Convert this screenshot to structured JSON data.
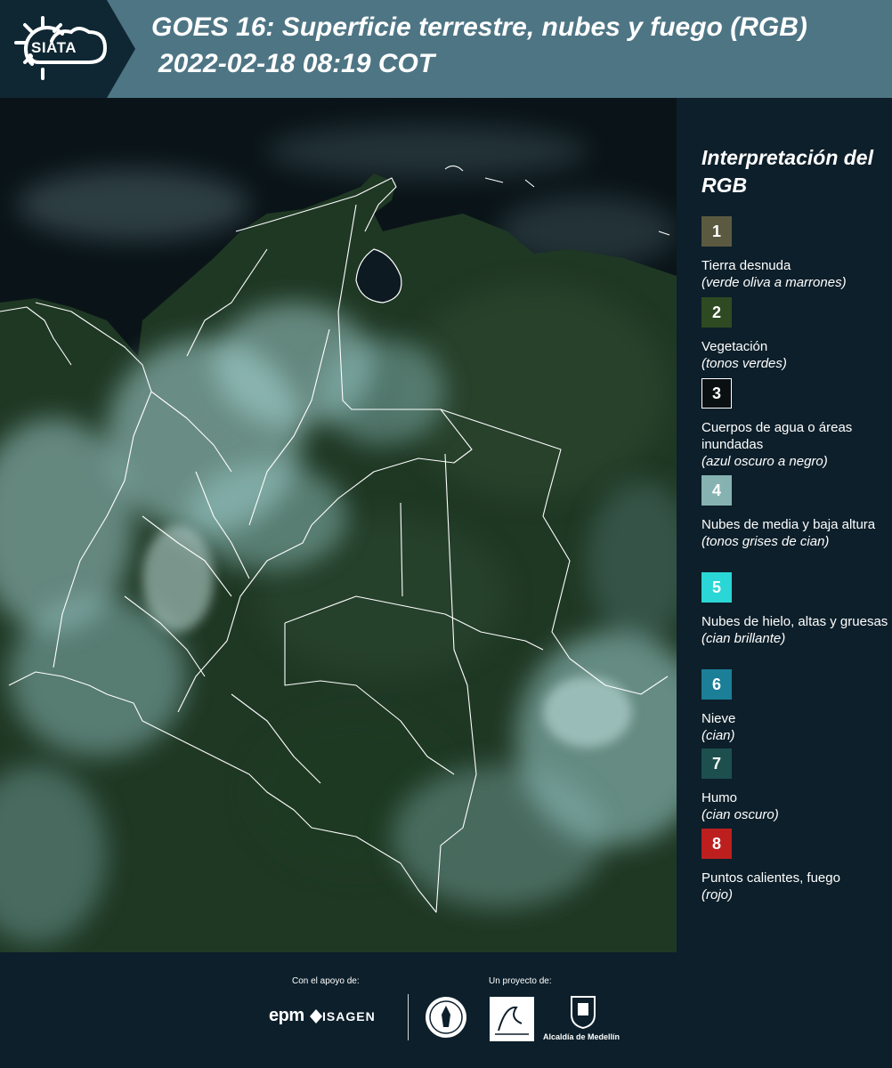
{
  "header": {
    "logo_text": "SIATA",
    "title": "GOES 16: Superficie terrestre, nubes y fuego (RGB)",
    "datetime": "2022-02-18 08:19 COT"
  },
  "legend": {
    "title": "Interpretación del RGB",
    "items": [
      {
        "number": "1",
        "label": "Tierra desnuda",
        "note": "(verde oliva a marrones)",
        "color": "#5b5a40"
      },
      {
        "number": "2",
        "label": "Vegetación",
        "note": "(tonos verdes)",
        "color": "#2e4a22"
      },
      {
        "number": "3",
        "label": "Cuerpos de agua o áreas inundadas",
        "note": "(azul oscuro a negro)",
        "color": "#0a0f12"
      },
      {
        "number": "4",
        "label": "Nubes de media y baja altura",
        "note": "(tonos grises de cian)",
        "color": "#86b3b1"
      },
      {
        "number": "5",
        "label": "Nubes de hielo, altas y gruesas",
        "note": "(cian brillante)",
        "color": "#2ad6d6"
      },
      {
        "number": "6",
        "label": "Nieve",
        "note": "(cian)",
        "color": "#1a7f97"
      },
      {
        "number": "7",
        "label": "Humo",
        "note": "(cian oscuro)",
        "color": "#1d4f4f"
      },
      {
        "number": "8",
        "label": "Puntos calientes, fuego",
        "note": "(rojo)",
        "color": "#bd1f1f"
      }
    ]
  },
  "footer": {
    "support_label": "Con el apoyo de:",
    "project_label": "Un proyecto de:",
    "epm": "epm",
    "isagen": "ISAGEN",
    "alcaldia": "Alcaldía de Medellín"
  }
}
